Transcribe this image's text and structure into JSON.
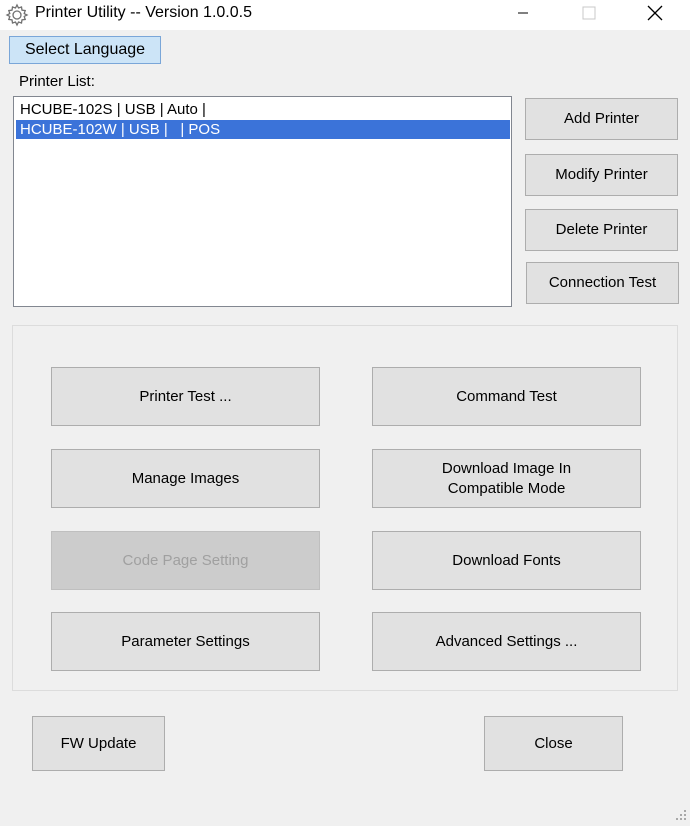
{
  "window": {
    "title": "Printer Utility -- Version 1.0.0.5",
    "icon": "gear-icon",
    "controls": {
      "minimize": "minimize-icon",
      "maximize": "maximize-icon",
      "close": "close-icon"
    }
  },
  "menu": {
    "select_language": "Select Language"
  },
  "printer_list": {
    "label": "Printer List:",
    "items": [
      {
        "text": "HCUBE-102S | USB | Auto |",
        "selected": false
      },
      {
        "text": "HCUBE-102W | USB |   | POS",
        "selected": true
      }
    ]
  },
  "side_buttons": {
    "add": "Add Printer",
    "modify": "Modify Printer",
    "delete": "Delete Printer",
    "connection_test": "Connection Test"
  },
  "tools": {
    "printer_test": "Printer Test ...",
    "command_test": "Command Test",
    "manage_images": "Manage Images",
    "download_image_compat": "Download Image In\nCompatible Mode",
    "code_page_setting": "Code Page Setting",
    "download_fonts": "Download Fonts",
    "parameter_settings": "Parameter Settings",
    "advanced_settings": "Advanced Settings ..."
  },
  "footer": {
    "fw_update": "FW Update",
    "close": "Close"
  },
  "colors": {
    "selection": "#3b73d9",
    "button_face": "#e1e1e1",
    "button_border": "#adadad",
    "disabled_text": "#a0a0a0",
    "lang_button_bg": "#cce4f7"
  }
}
